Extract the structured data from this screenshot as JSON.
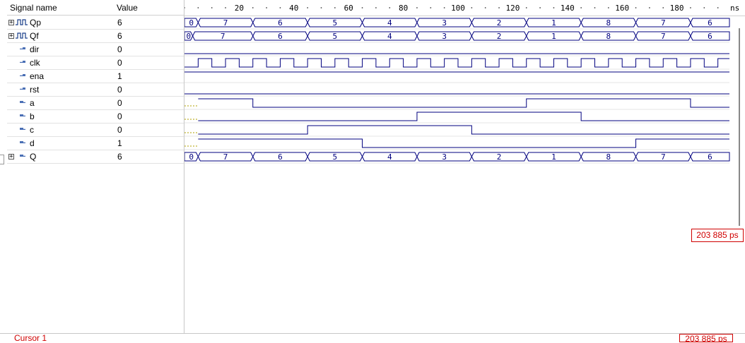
{
  "header": {
    "name_col": "Signal name",
    "value_col": "Value"
  },
  "ruler": {
    "unit": "ns",
    "ticks": [
      "20",
      "40",
      "60",
      "80",
      "100",
      "120",
      "140",
      "160",
      "180"
    ]
  },
  "signals": [
    {
      "name": "Qp",
      "value": "6",
      "kind": "bus",
      "icon": "clock-bus-icon",
      "expandable": true
    },
    {
      "name": "Qf",
      "value": "6",
      "kind": "bus",
      "icon": "clock-bus-icon",
      "expandable": true
    },
    {
      "name": "dir",
      "value": "0",
      "kind": "bit",
      "icon": "input-pin-icon",
      "expandable": false
    },
    {
      "name": "clk",
      "value": "0",
      "kind": "clock",
      "icon": "input-pin-icon",
      "expandable": false
    },
    {
      "name": "ena",
      "value": "1",
      "kind": "bit",
      "icon": "input-pin-icon",
      "expandable": false
    },
    {
      "name": "rst",
      "value": "0",
      "kind": "bit",
      "icon": "input-pin-icon",
      "expandable": false
    },
    {
      "name": "a",
      "value": "0",
      "kind": "bit",
      "icon": "output-pin-icon",
      "expandable": false
    },
    {
      "name": "b",
      "value": "0",
      "kind": "bit",
      "icon": "output-pin-icon",
      "expandable": false
    },
    {
      "name": "c",
      "value": "0",
      "kind": "bit",
      "icon": "output-pin-icon",
      "expandable": false
    },
    {
      "name": "d",
      "value": "1",
      "kind": "bit",
      "icon": "output-pin-icon",
      "expandable": false
    },
    {
      "name": "Q",
      "value": "6",
      "kind": "bus",
      "icon": "output-pin-icon",
      "expandable": true
    }
  ],
  "waves": {
    "time_end_ns": 200,
    "Qp": {
      "segments": [
        [
          0,
          "0"
        ],
        [
          5,
          "7"
        ],
        [
          25,
          "6"
        ],
        [
          45,
          "5"
        ],
        [
          65,
          "4"
        ],
        [
          85,
          "3"
        ],
        [
          105,
          "2"
        ],
        [
          125,
          "1"
        ],
        [
          145,
          "8"
        ],
        [
          165,
          "7"
        ],
        [
          185,
          "6"
        ]
      ]
    },
    "Qf": {
      "segments": [
        [
          0,
          "0"
        ],
        [
          3,
          "7"
        ],
        [
          25,
          "6"
        ],
        [
          45,
          "5"
        ],
        [
          65,
          "4"
        ],
        [
          85,
          "3"
        ],
        [
          105,
          "2"
        ],
        [
          125,
          "1"
        ],
        [
          145,
          "8"
        ],
        [
          165,
          "7"
        ],
        [
          185,
          "6"
        ]
      ]
    },
    "Q": {
      "segments": [
        [
          0,
          "0"
        ],
        [
          5,
          "7"
        ],
        [
          25,
          "6"
        ],
        [
          45,
          "5"
        ],
        [
          65,
          "4"
        ],
        [
          85,
          "3"
        ],
        [
          105,
          "2"
        ],
        [
          125,
          "1"
        ],
        [
          145,
          "8"
        ],
        [
          165,
          "7"
        ],
        [
          185,
          "6"
        ]
      ]
    },
    "dir": {
      "edges": [
        [
          0,
          0
        ]
      ]
    },
    "clk": {
      "period_ns": 10,
      "high_first_ns": 5
    },
    "ena": {
      "edges": [
        [
          0,
          1
        ]
      ]
    },
    "rst": {
      "edges": [
        [
          0,
          0
        ]
      ]
    },
    "a": {
      "unknown_until_ns": 5,
      "edges": [
        [
          5,
          1
        ],
        [
          25,
          0
        ],
        [
          125,
          1
        ],
        [
          185,
          0
        ]
      ]
    },
    "b": {
      "unknown_until_ns": 5,
      "edges": [
        [
          5,
          0
        ],
        [
          85,
          1
        ],
        [
          145,
          0
        ]
      ]
    },
    "c": {
      "unknown_until_ns": 5,
      "edges": [
        [
          5,
          0
        ],
        [
          45,
          1
        ],
        [
          105,
          0
        ]
      ]
    },
    "d": {
      "unknown_until_ns": 5,
      "edges": [
        [
          5,
          1
        ],
        [
          65,
          0
        ],
        [
          165,
          1
        ]
      ]
    }
  },
  "cursor": {
    "time_label": "203 885 ps",
    "name": "Cursor 1",
    "bottom_label": "203 885 ps"
  },
  "colors": {
    "wave": "#00007f",
    "bus_text": "#00007f",
    "unknown": "#b0a000",
    "cursor": "#d00000"
  }
}
